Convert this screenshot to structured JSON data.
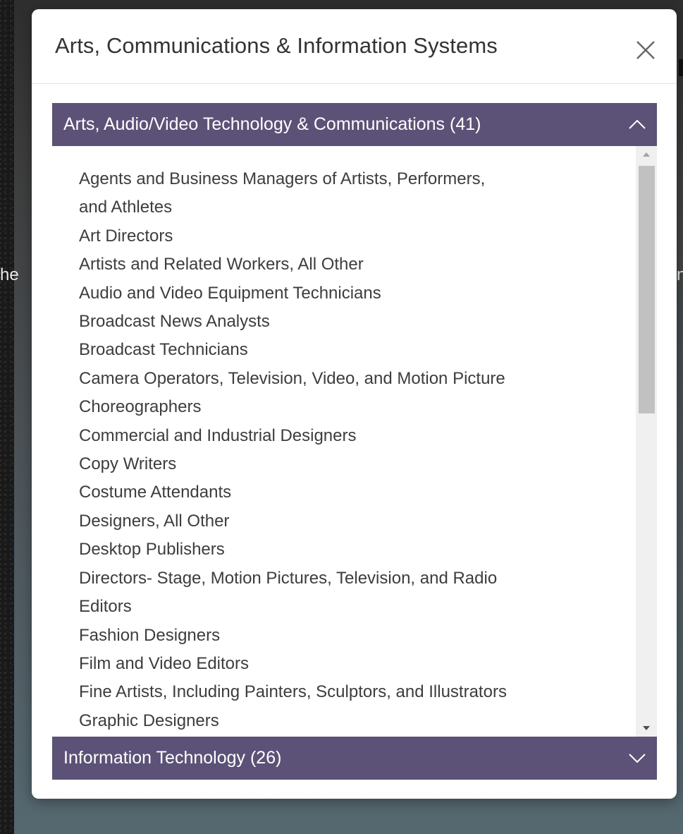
{
  "background": {
    "left_text": "he",
    "right_text": "n"
  },
  "modal": {
    "title": "Arts, Communications & Information Systems",
    "close_icon": "close-icon"
  },
  "accordion": [
    {
      "label": "Arts, Audio/Video Technology & Communications (41)",
      "expanded": true,
      "icon": "chevron-up-icon",
      "items": [
        "Agents and Business Managers of Artists, Performers,",
        "and Athletes",
        "Art Directors",
        "Artists and Related Workers, All Other",
        "Audio and Video Equipment Technicians",
        "Broadcast News Analysts",
        "Broadcast Technicians",
        "Camera Operators, Television, Video, and Motion Picture",
        "Choreographers",
        "Commercial and Industrial Designers",
        "Copy Writers",
        "Costume Attendants",
        "Designers, All Other",
        "Desktop Publishers",
        "Directors- Stage, Motion Pictures, Television, and Radio",
        "Editors",
        "Fashion Designers",
        "Film and Video Editors",
        "Fine Artists, Including Painters, Sculptors, and Illustrators",
        "Graphic Designers"
      ]
    },
    {
      "label": "Information Technology (26)",
      "expanded": false,
      "icon": "chevron-down-icon"
    }
  ],
  "colors": {
    "accordion_header": "#5c5277",
    "modal_bg": "#ffffff",
    "list_text": "#3d3d3d"
  }
}
